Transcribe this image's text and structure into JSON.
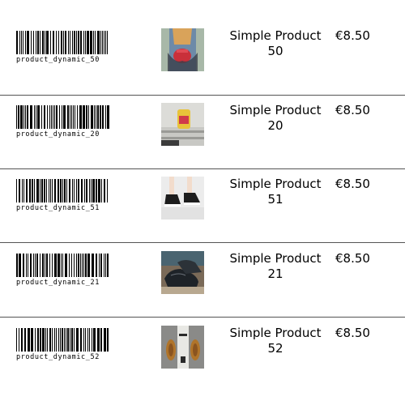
{
  "products": [
    {
      "sku": "product_dynamic_50",
      "name_line1": "Simple Product",
      "name_line2": "50",
      "price": "€8.50",
      "image": "person-holding-red-cup-photo",
      "palette": {
        "bg": "#a8b8a8",
        "main": "#c9303a",
        "accent": "#6d8aa8",
        "dark": "#3a3f4a"
      }
    },
    {
      "sku": "product_dynamic_20",
      "name_line1": "Simple Product",
      "name_line2": "20",
      "price": "€8.50",
      "image": "yellow-backpack-on-bench-photo",
      "palette": {
        "bg": "#dcdcd8",
        "main": "#e8c33a",
        "accent": "#d03a4a",
        "dark": "#3b3b3b"
      }
    },
    {
      "sku": "product_dynamic_51",
      "name_line1": "Simple Product",
      "name_line2": "51",
      "price": "€8.50",
      "image": "black-sneakers-feet-photo",
      "palette": {
        "bg": "#ececec",
        "main": "#1d1d1d",
        "accent": "#f2dccc",
        "dark": "#ffffff"
      }
    },
    {
      "sku": "product_dynamic_21",
      "name_line1": "Simple Product",
      "name_line2": "21",
      "price": "€8.50",
      "image": "black-leather-shoes-photo",
      "palette": {
        "bg": "#7a6a58",
        "main": "#1e2328",
        "accent": "#4a6470",
        "dark": "#b8a890"
      }
    },
    {
      "sku": "product_dynamic_52",
      "name_line1": "Simple Product",
      "name_line2": "52",
      "price": "€8.50",
      "image": "brown-shoes-flatlay-photo",
      "palette": {
        "bg": "#8a8a88",
        "main": "#b0742a",
        "accent": "#e8e8e4",
        "dark": "#2a2a2a"
      }
    }
  ]
}
